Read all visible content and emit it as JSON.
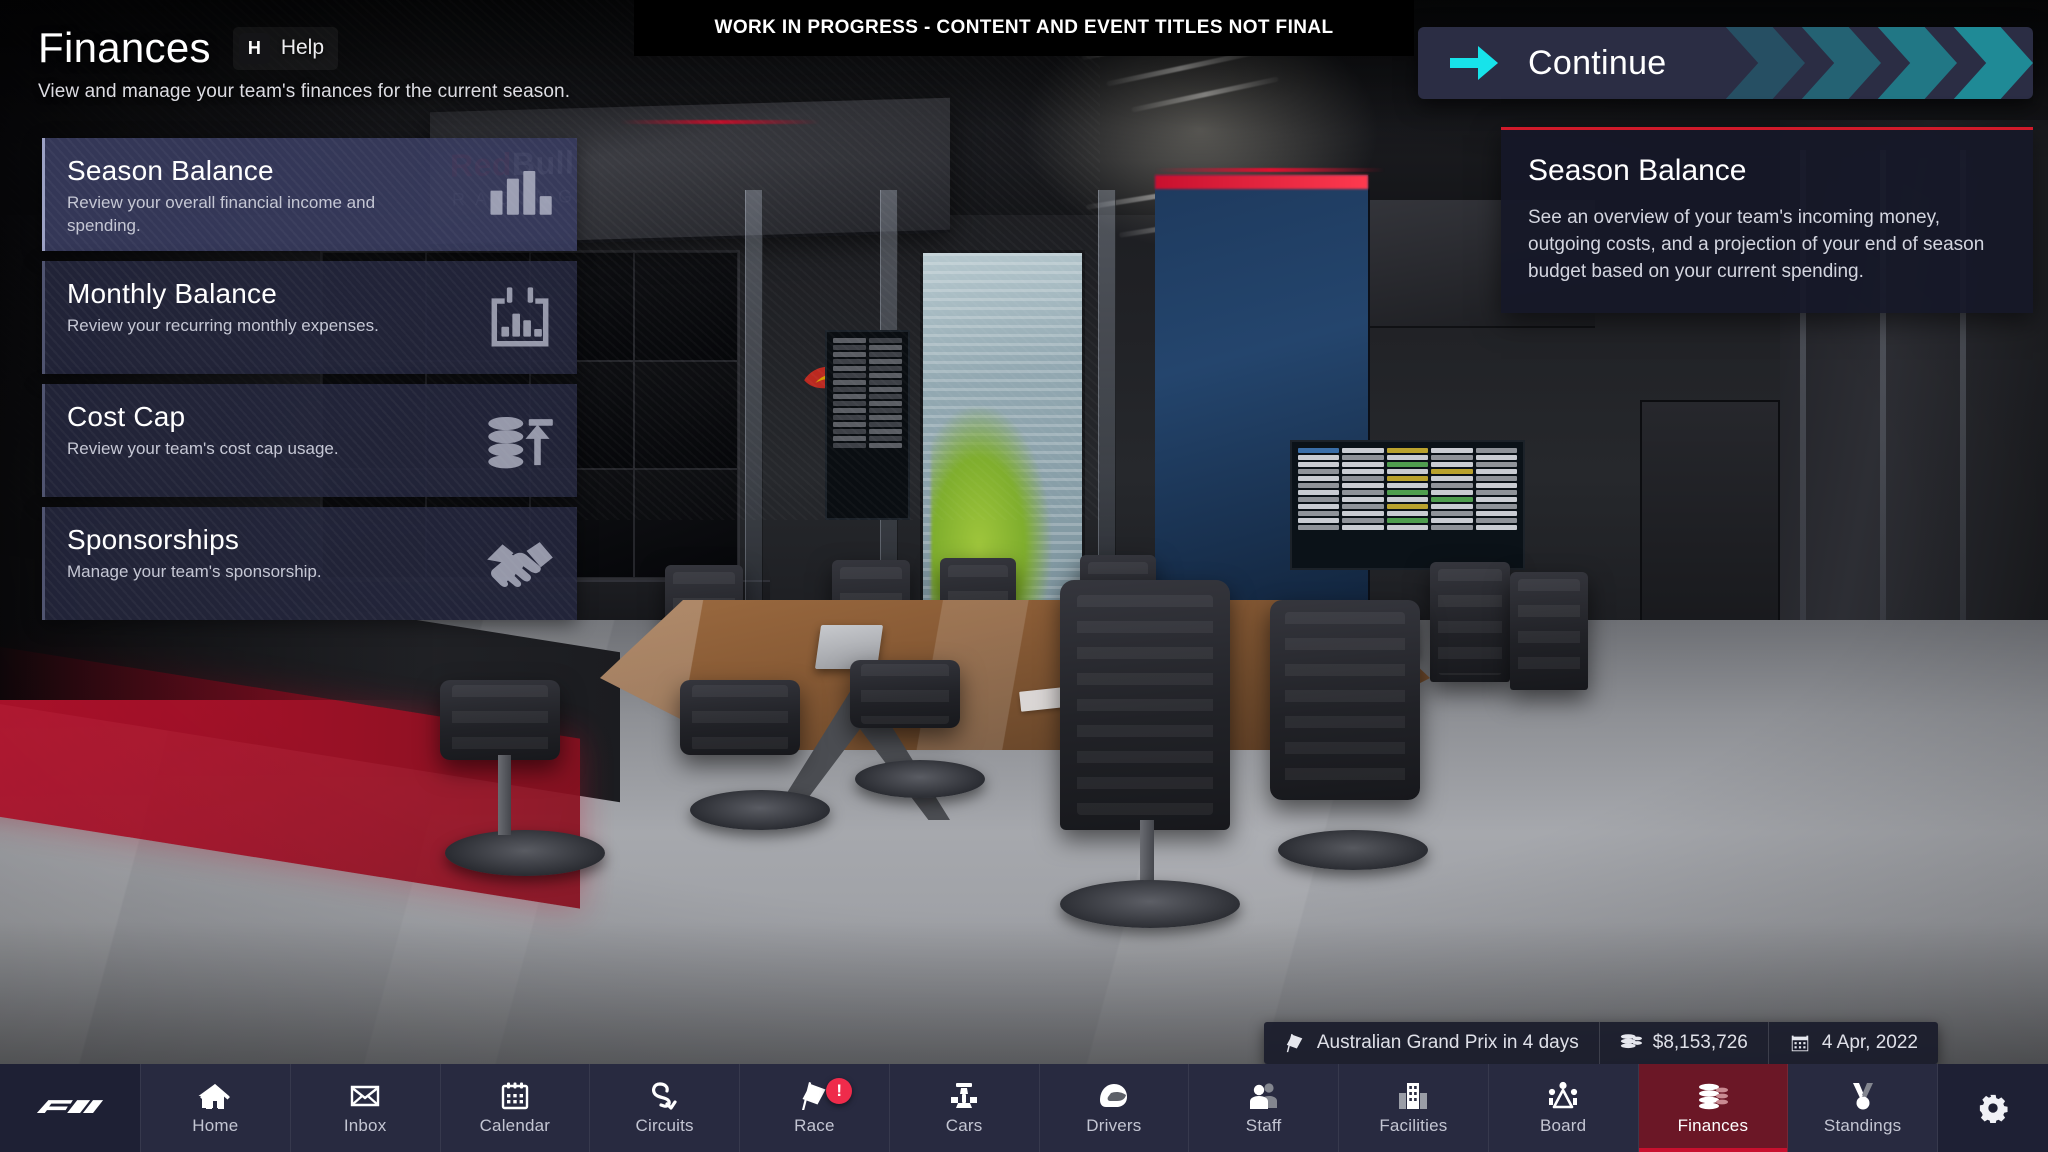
{
  "banner": {
    "text": "WORK IN PROGRESS - CONTENT AND EVENT TITLES NOT FINAL"
  },
  "header": {
    "title": "Finances",
    "subtitle": "View and manage your team's finances for the current season.",
    "help_key": "H",
    "help_label": "Help"
  },
  "cards": [
    {
      "title": "Season Balance",
      "desc": "Review your overall financial income and spending.",
      "icon": "bar-chart-icon",
      "selected": true
    },
    {
      "title": "Monthly Balance",
      "desc": "Review your recurring monthly expenses.",
      "icon": "monthly-chart-icon",
      "selected": false
    },
    {
      "title": "Cost Cap",
      "desc": "Review your team's cost cap usage.",
      "icon": "cost-cap-icon",
      "selected": false
    },
    {
      "title": "Sponsorships",
      "desc": "Manage your team's sponsorship.",
      "icon": "handshake-icon",
      "selected": false
    }
  ],
  "continue_button": {
    "label": "Continue",
    "icon": "arrow-right-icon"
  },
  "tooltip": {
    "title": "Season Balance",
    "body": "See an overview of your team's incoming money, outgoing costs, and a projection of your end of season budget based on your current spending."
  },
  "status_bar": [
    {
      "icon": "race-flag-icon",
      "text": "Australian Grand Prix in 4 days"
    },
    {
      "icon": "money-stack-icon",
      "text": "$8,153,726"
    },
    {
      "icon": "calendar-icon",
      "text": "4 Apr, 2022"
    }
  ],
  "nav": {
    "logo": "f1-logo",
    "items": [
      {
        "label": "Home",
        "icon": "home-icon",
        "active": false,
        "badge": null
      },
      {
        "label": "Inbox",
        "icon": "mail-icon",
        "active": false,
        "badge": null
      },
      {
        "label": "Calendar",
        "icon": "calendar-icon",
        "active": false,
        "badge": null
      },
      {
        "label": "Circuits",
        "icon": "circuit-icon",
        "active": false,
        "badge": null
      },
      {
        "label": "Race",
        "icon": "race-flag-icon",
        "active": false,
        "badge": "!"
      },
      {
        "label": "Cars",
        "icon": "car-icon",
        "active": false,
        "badge": null
      },
      {
        "label": "Drivers",
        "icon": "helmet-icon",
        "active": false,
        "badge": null
      },
      {
        "label": "Staff",
        "icon": "people-icon",
        "active": false,
        "badge": null
      },
      {
        "label": "Facilities",
        "icon": "building-icon",
        "active": false,
        "badge": null
      },
      {
        "label": "Board",
        "icon": "board-icon",
        "active": false,
        "badge": null
      },
      {
        "label": "Finances",
        "icon": "money-stack-icon",
        "active": true,
        "badge": null
      },
      {
        "label": "Standings",
        "icon": "medal-icon",
        "active": false,
        "badge": null
      }
    ],
    "settings_icon": "gear-icon"
  },
  "colors": {
    "accent_cyan": "#17e3ea",
    "accent_red": "#c8102e",
    "card_bg": "#24263b",
    "card_selected_bg": "#373a5c",
    "nav_bg": "#282a40",
    "nav_active_bg": "#6b1726",
    "badge_red": "#ef2b4b"
  }
}
